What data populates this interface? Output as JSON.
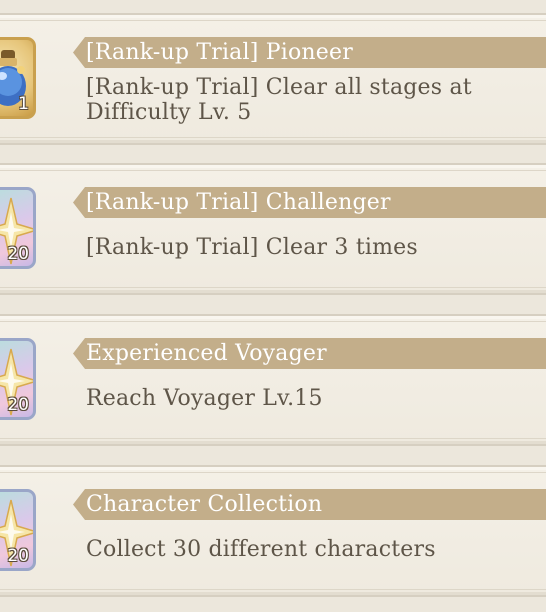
{
  "achievements": [
    {
      "title": "[Rank-up Trial] Pioneer",
      "description": "[Rank-up Trial] Clear all stages at Difficulty Lv. 5",
      "reward_qty": "1",
      "reward_icon": "potion-icon"
    },
    {
      "title": "[Rank-up Trial] Challenger",
      "description": "[Rank-up Trial] Clear 3 times",
      "reward_qty": "20",
      "reward_icon": "crystal-star-icon"
    },
    {
      "title": "Experienced Voyager",
      "description": "Reach Voyager Lv.15",
      "reward_qty": "20",
      "reward_icon": "crystal-star-icon"
    },
    {
      "title": "Character Collection",
      "description": "Collect 30 different characters",
      "reward_qty": "20",
      "reward_icon": "crystal-star-icon"
    }
  ],
  "colors": {
    "background": "#ece7dc",
    "title_bar": "#c3ae8a",
    "description_text": "#5e5548"
  }
}
